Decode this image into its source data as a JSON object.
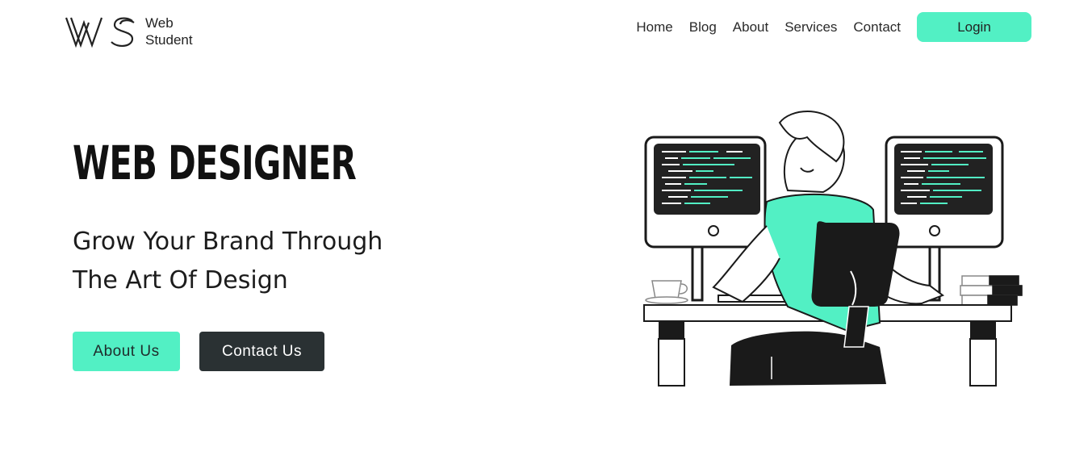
{
  "brand": {
    "mark": "WS",
    "name_line1": "Web",
    "name_line2": "Student"
  },
  "nav": {
    "links": [
      "Home",
      "Blog",
      "About",
      "Services",
      "Contact"
    ],
    "login_label": "Login"
  },
  "hero": {
    "title": "WEB DESIGNER",
    "subtitle_line1": "Grow Your Brand Through",
    "subtitle_line2": "The Art Of Design",
    "about_button": "About Us",
    "contact_button": "Contact Us"
  },
  "colors": {
    "accent": "#52f0c4",
    "dark": "#2a3133",
    "text": "#111111",
    "background": "#ffffff"
  },
  "illustration": {
    "icon": "developer-at-desk-illustration"
  }
}
